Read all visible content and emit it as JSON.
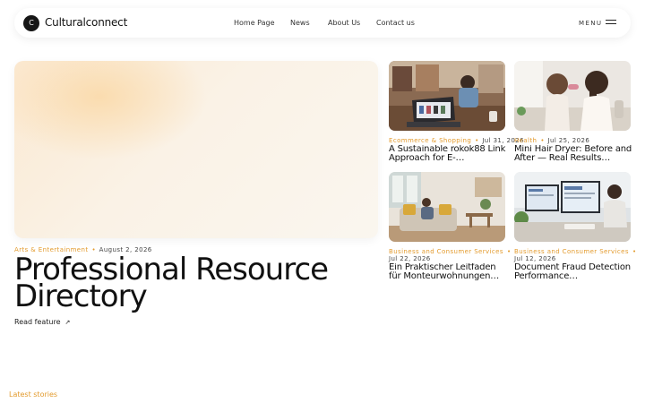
{
  "brand": {
    "logo_letter": "C",
    "name": "Culturalconnect"
  },
  "nav": {
    "items": [
      "Home Page",
      "News",
      "About Us",
      "Contact us"
    ]
  },
  "menu": {
    "label": "MENU"
  },
  "hero": {
    "category": "Arts & Entertainment",
    "separator": "•",
    "date": "August 2, 2026",
    "title": "Professional Resource Directory",
    "read_label": "Read feature",
    "read_arrow": "↗"
  },
  "cards": [
    {
      "category": "Ecommerce & Shopping",
      "date": "Jul 31, 2026",
      "title": "A Sustainable rokok88 Link Approach for E-…"
    },
    {
      "category": "Health",
      "date": "Jul 25, 2026",
      "title": "Mini Hair Dryer: Before and After — Real Results…"
    },
    {
      "category": "Business and Consumer Services",
      "date": "Jul 22, 2026",
      "title": "Ein Praktischer Leitfaden für Monteurwohnungen…"
    },
    {
      "category": "Business and Consumer Services",
      "date": "Jul 12, 2026",
      "title": "Document Fraud Detection Performance…"
    }
  ],
  "latest": {
    "label": "Latest stories"
  },
  "colors": {
    "accent": "#e39b2e",
    "text": "#111111",
    "background": "#ffffff"
  }
}
